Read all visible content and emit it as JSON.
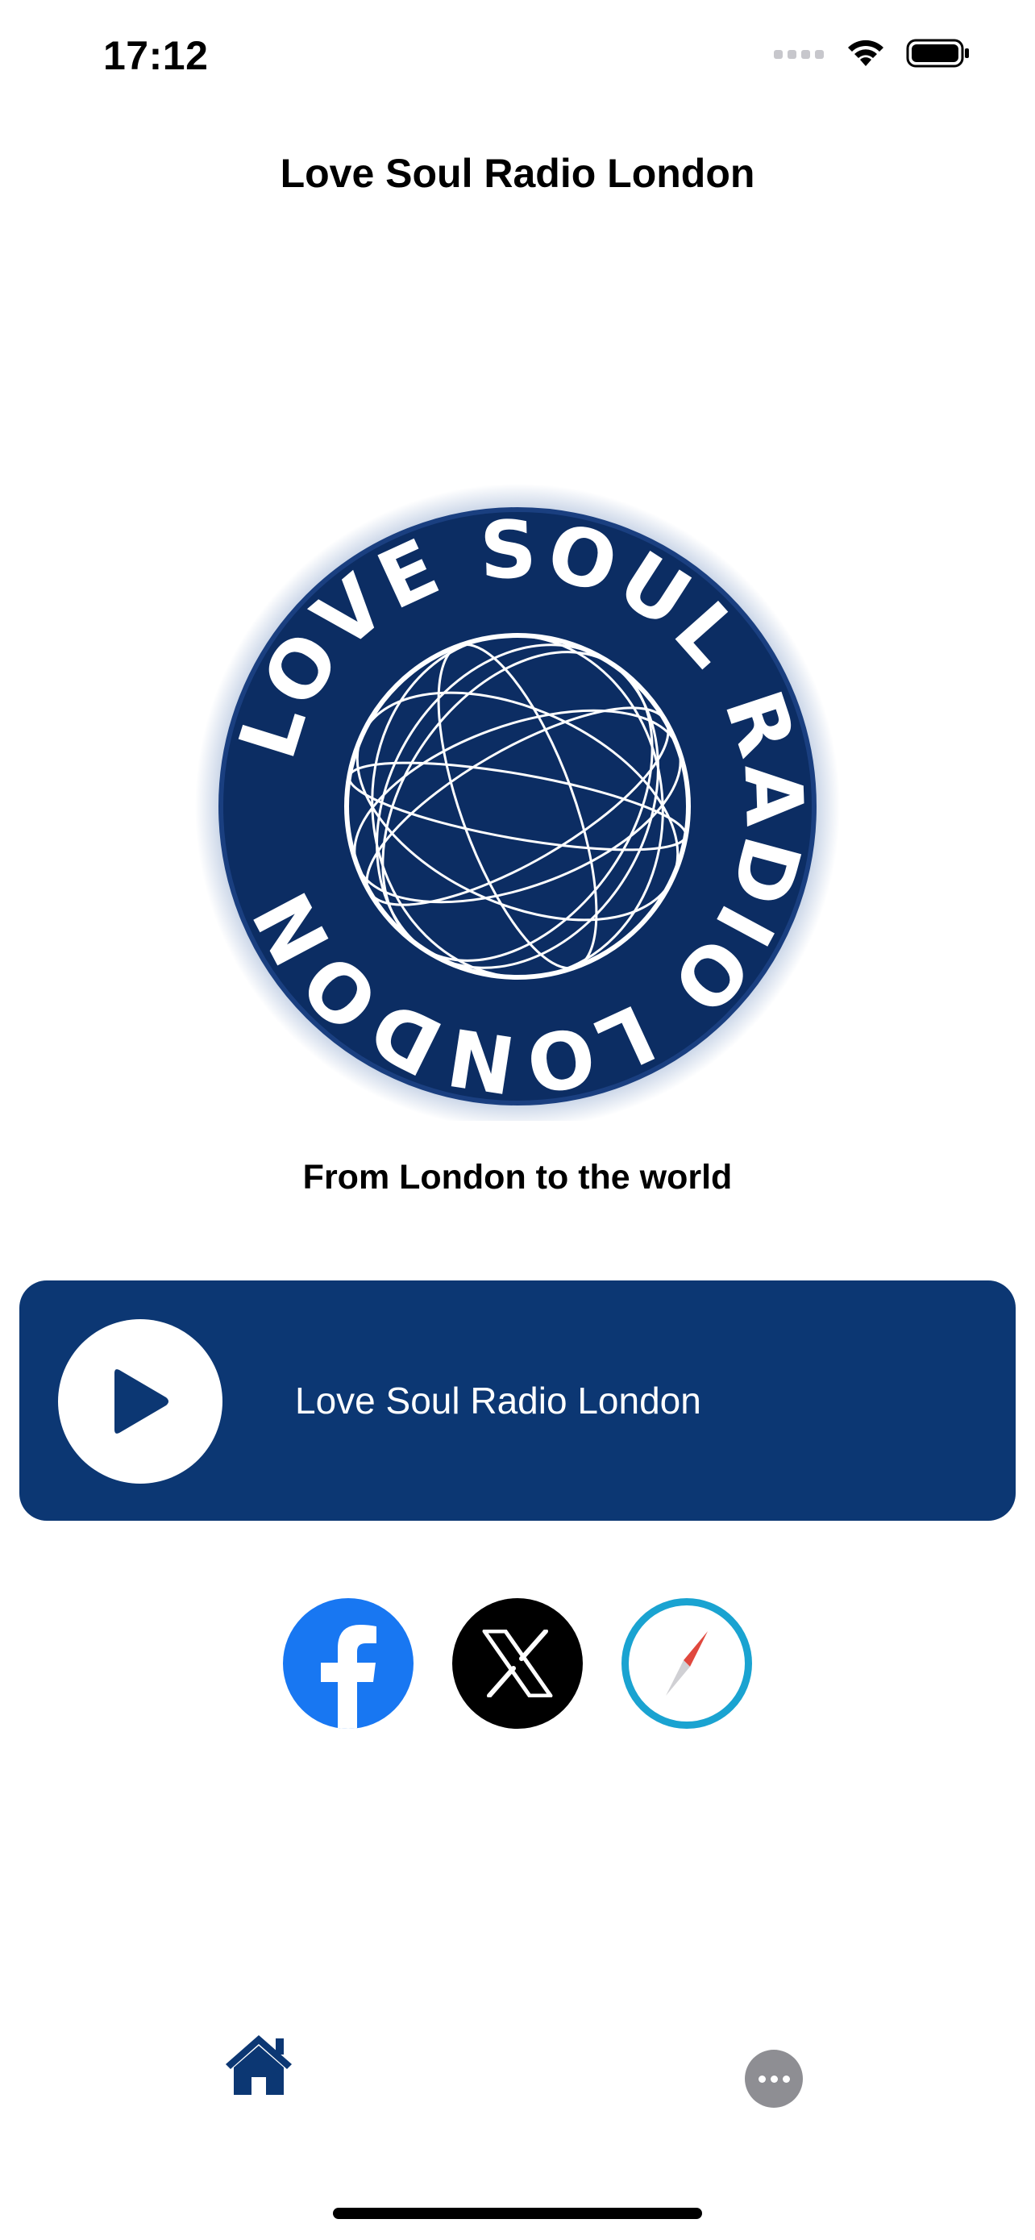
{
  "status_bar": {
    "time": "17:12"
  },
  "nav": {
    "title": "Love Soul Radio London"
  },
  "logo": {
    "text": "LOVE SOUL RADIO LONDON",
    "background_color": "#0c2d63",
    "icon": "globe-icon"
  },
  "tagline": "From London to the world",
  "player": {
    "station_name": "Love Soul Radio London",
    "card_color": "#0c3773",
    "play_icon": "play-icon"
  },
  "social": [
    {
      "name": "Facebook",
      "icon": "facebook-icon",
      "color": "#1877f2"
    },
    {
      "name": "X",
      "icon": "x-icon",
      "color": "#000000"
    },
    {
      "name": "Website",
      "icon": "compass-icon",
      "color": "#1aa3d1"
    }
  ],
  "tab_bar": {
    "items": [
      {
        "name": "Home",
        "icon": "home-icon",
        "selected": true,
        "color": "#0c3773"
      },
      {
        "name": "More",
        "icon": "more-icon",
        "selected": false,
        "color": "#8e8e93"
      }
    ]
  }
}
